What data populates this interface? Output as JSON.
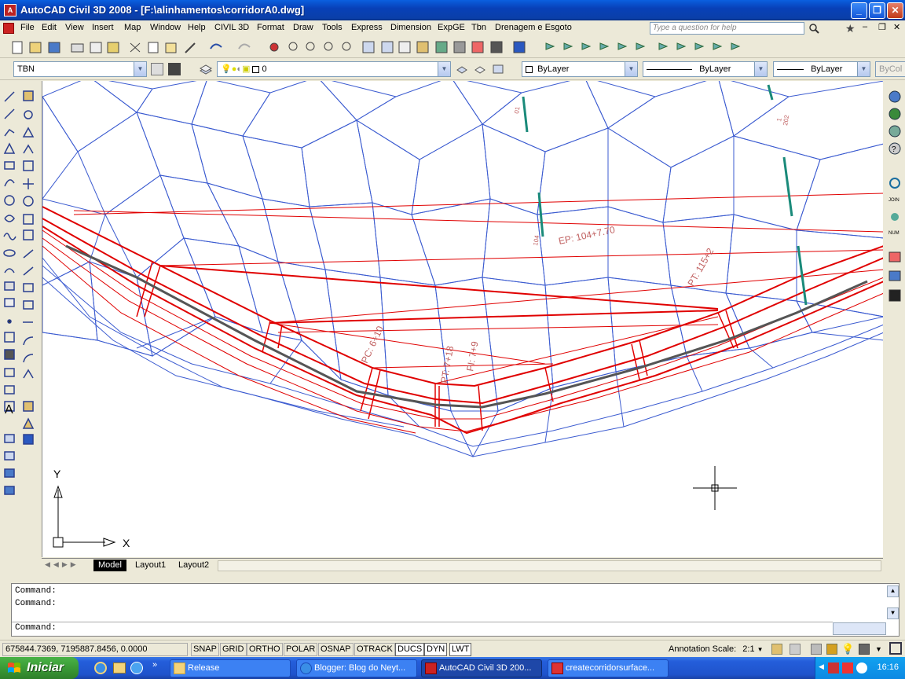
{
  "window": {
    "title": "AutoCAD Civil 3D 2008 - [F:\\alinhamentos\\corridorA0.dwg]"
  },
  "menu": {
    "items": [
      "File",
      "Edit",
      "View",
      "Insert",
      "Map",
      "Window",
      "Help",
      "CIVIL 3D",
      "Format",
      "Draw",
      "Tools",
      "Express",
      "Dimension",
      "ExpGE",
      "Tbn",
      "Drenagem e Esgoto"
    ],
    "help_placeholder": "Type a question for help"
  },
  "layers_toolbar": {
    "style_combo": "TBN",
    "layer_combo": "0",
    "color_combo": "ByLayer",
    "linetype_combo": "ByLayer",
    "lineweight_combo": "ByLayer",
    "plotstyle_combo": "ByCol"
  },
  "drawing": {
    "labels": [
      "EP: 104+7.70",
      "PT: 115+2",
      "PC: 6+10",
      "PT: 7+18",
      "PI: 7+9"
    ],
    "station_ticks": [
      "01",
      "1",
      "202",
      "104"
    ],
    "ucs_x": "X",
    "ucs_y": "Y"
  },
  "layout_tabs": [
    "Model",
    "Layout1",
    "Layout2"
  ],
  "command": {
    "lines": [
      "Command:",
      "Command:"
    ],
    "prompt": "Command:"
  },
  "status": {
    "coords": "675844.7369, 7195887.8456, 0.0000",
    "toggles": [
      "SNAP",
      "GRID",
      "ORTHO",
      "POLAR",
      "OSNAP",
      "OTRACK",
      "DUCS",
      "DYN",
      "LWT"
    ],
    "toggles_on": [
      "DUCS",
      "DYN",
      "LWT"
    ],
    "annotation_scale_label": "Annotation Scale:",
    "annotation_scale_value": "2:1"
  },
  "taskbar": {
    "start": "Iniciar",
    "tasks": [
      "Release",
      "Blogger: Blog do Neyt...",
      "AutoCAD Civil 3D 200...",
      "createcorridorsurface..."
    ],
    "active_task": "AutoCAD Civil 3D 200...",
    "clock": "16:16"
  },
  "colors": {
    "tin": "#3050c8",
    "corridor": "#e00000",
    "alignment": "#555555",
    "label": "#c06060",
    "teal": "#1a8a7a"
  }
}
